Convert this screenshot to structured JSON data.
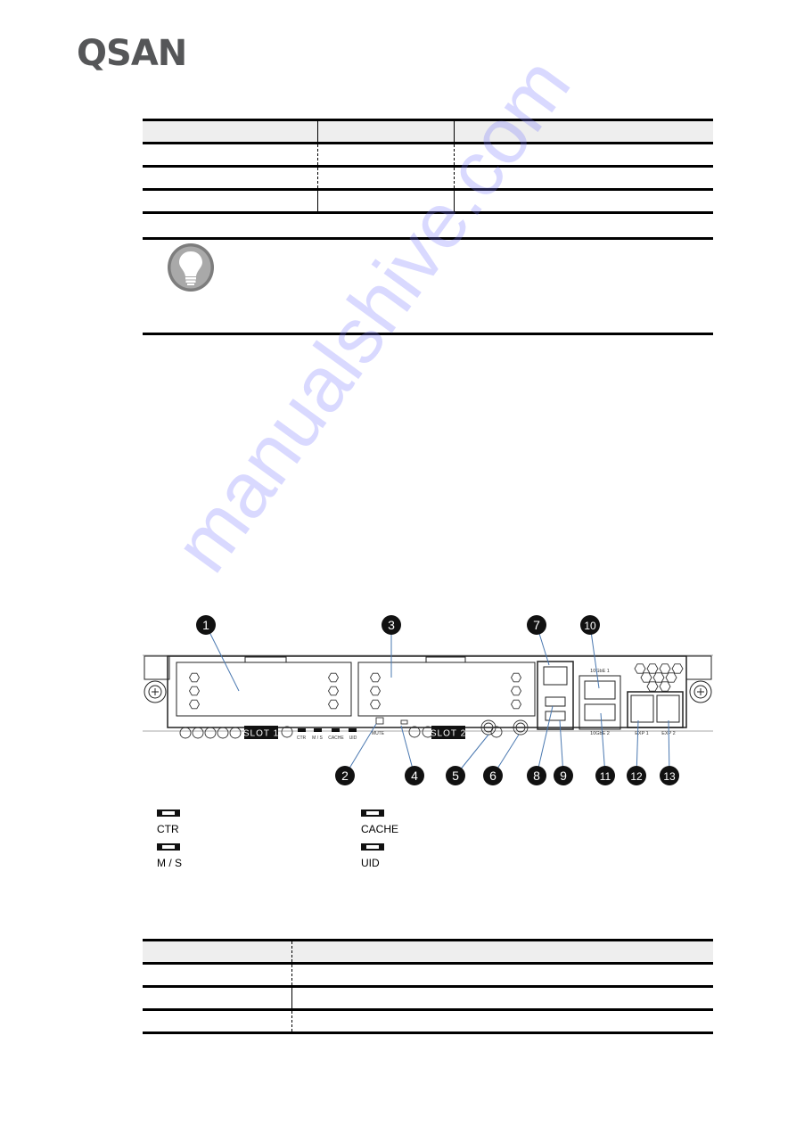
{
  "header": {
    "logo_text": "QSAN"
  },
  "table1": {
    "rows": [
      [
        "",
        "",
        ""
      ],
      [
        "",
        "",
        ""
      ],
      [
        "",
        "",
        ""
      ],
      [
        "",
        "",
        ""
      ]
    ]
  },
  "note": {
    "icon": "lightbulb-icon",
    "text": ""
  },
  "diagram": {
    "callouts": [
      "1",
      "2",
      "3",
      "4",
      "5",
      "6",
      "7",
      "8",
      "9",
      "10",
      "11",
      "12",
      "13"
    ],
    "labels": {
      "slot1": "SLOT 1",
      "slot2": "SLOT 2",
      "ctr": "CTR",
      "ms": "M / S",
      "cache": "CACHE",
      "uid": "UID",
      "mute": "MUTE",
      "port_10gbe1": "10GbE 1",
      "port_10gbe2": "10GbE 2",
      "exp1": "EXP 1",
      "exp2": "EXP 2",
      "usb_mgmt": "⚗ / ⭠"
    }
  },
  "led_legend": {
    "left": [
      {
        "label": "CTR"
      },
      {
        "label": "M / S"
      }
    ],
    "right": [
      {
        "label": "CACHE"
      },
      {
        "label": "UID"
      }
    ]
  },
  "table2": {
    "rows": [
      [
        "",
        ""
      ],
      [
        "",
        ""
      ],
      [
        "",
        ""
      ],
      [
        "",
        ""
      ]
    ]
  },
  "watermark": "manualshive.com",
  "colors": {
    "logo": "#555658",
    "callout_fill": "#111111",
    "leader_line": "#4a78b0",
    "table_header_bg": "#eeeeee"
  }
}
